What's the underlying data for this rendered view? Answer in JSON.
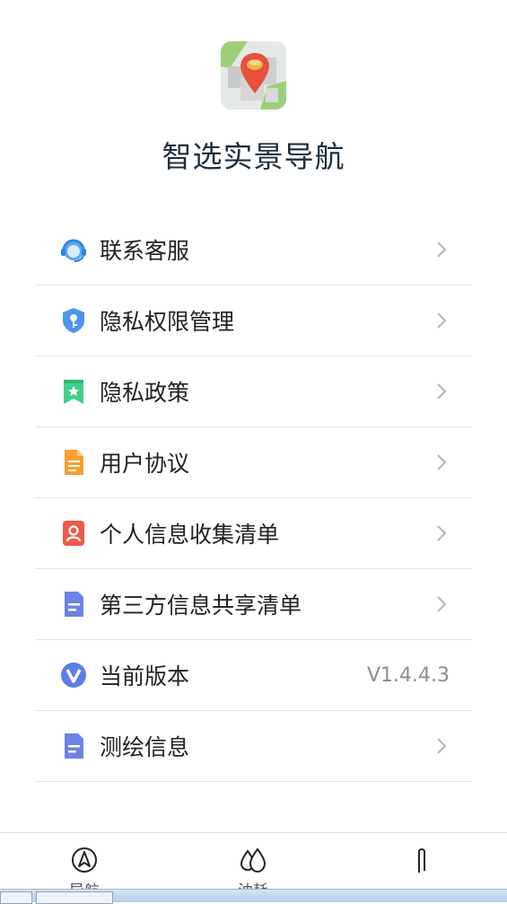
{
  "app": {
    "title": "智选实景导航",
    "icon": "map-pin-app-icon"
  },
  "menu": {
    "items": [
      {
        "label": "联系客服",
        "icon": "headset-icon",
        "chevron": true
      },
      {
        "label": "隐私权限管理",
        "icon": "shield-key-icon",
        "chevron": true
      },
      {
        "label": "隐私政策",
        "icon": "bookmark-star-icon",
        "chevron": true
      },
      {
        "label": "用户协议",
        "icon": "document-icon",
        "chevron": true
      },
      {
        "label": "个人信息收集清单",
        "icon": "person-card-icon",
        "chevron": true
      },
      {
        "label": "第三方信息共享清单",
        "icon": "file-lines-icon",
        "chevron": true
      },
      {
        "label": "当前版本",
        "icon": "version-v-icon",
        "value": "V1.4.4.3"
      },
      {
        "label": "测绘信息",
        "icon": "file-lines-icon",
        "chevron": true
      }
    ]
  },
  "tabbar": {
    "tabs": [
      {
        "label": "导航",
        "icon": "navigation-arrow-icon"
      },
      {
        "label": "油耗",
        "icon": "fuel-drops-icon"
      },
      {
        "label": "",
        "icon": "paperclip-icon"
      }
    ]
  },
  "colors": {
    "title": "#1f2f3c",
    "divider": "#e6e6e6",
    "value_text": "#8e8e8e",
    "chevron": "#b5b5b5"
  }
}
